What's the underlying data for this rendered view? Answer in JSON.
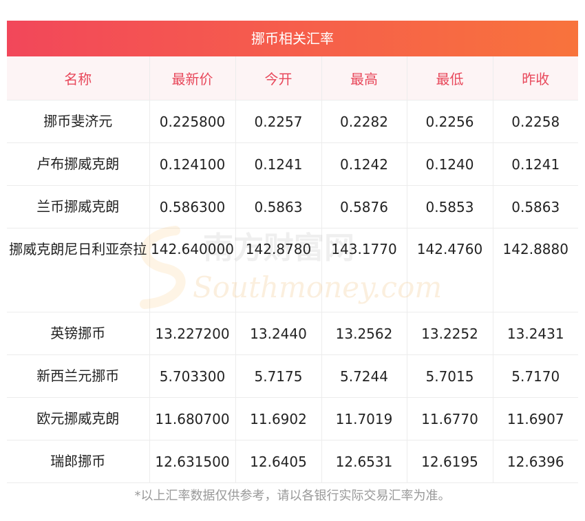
{
  "title": "挪币相关汇率",
  "columns": [
    "名称",
    "最新价",
    "今开",
    "最高",
    "最低",
    "昨收"
  ],
  "rows": [
    {
      "name": "挪币斐济元",
      "values": [
        "0.225800",
        "0.2257",
        "0.2282",
        "0.2256",
        "0.2258"
      ]
    },
    {
      "name": "卢布挪威克朗",
      "values": [
        "0.124100",
        "0.1241",
        "0.1242",
        "0.1240",
        "0.1241"
      ]
    },
    {
      "name": "兰币挪威克朗",
      "values": [
        "0.586300",
        "0.5863",
        "0.5876",
        "0.5853",
        "0.5863"
      ]
    },
    {
      "name": "挪威克朗尼日利亚奈拉",
      "values": [
        "142.640000",
        "142.8780",
        "143.1770",
        "142.4760",
        "142.8880"
      ]
    },
    {
      "name": "英镑挪币",
      "values": [
        "13.227200",
        "13.2440",
        "13.2562",
        "13.2252",
        "13.2431"
      ]
    },
    {
      "name": "新西兰元挪币",
      "values": [
        "5.703300",
        "5.7175",
        "5.7244",
        "5.7015",
        "5.7170"
      ]
    },
    {
      "name": "欧元挪威克朗",
      "values": [
        "11.680700",
        "11.6902",
        "11.7019",
        "11.6770",
        "11.6907"
      ]
    },
    {
      "name": "瑞郎挪币",
      "values": [
        "12.631500",
        "12.6405",
        "12.6531",
        "12.6195",
        "12.6396"
      ]
    }
  ],
  "footnote": "*以上汇率数据仅供参考，请以各银行实际交易汇率为准。",
  "watermark": {
    "cn": "南方财富网",
    "en": "Southmoney.com"
  },
  "colors": {
    "header_text": "#e8485b",
    "header_bg": "#fdf4f5",
    "title_gradient_start": "#f2475a",
    "title_gradient_end": "#f8733c",
    "footnote": "#999999"
  }
}
